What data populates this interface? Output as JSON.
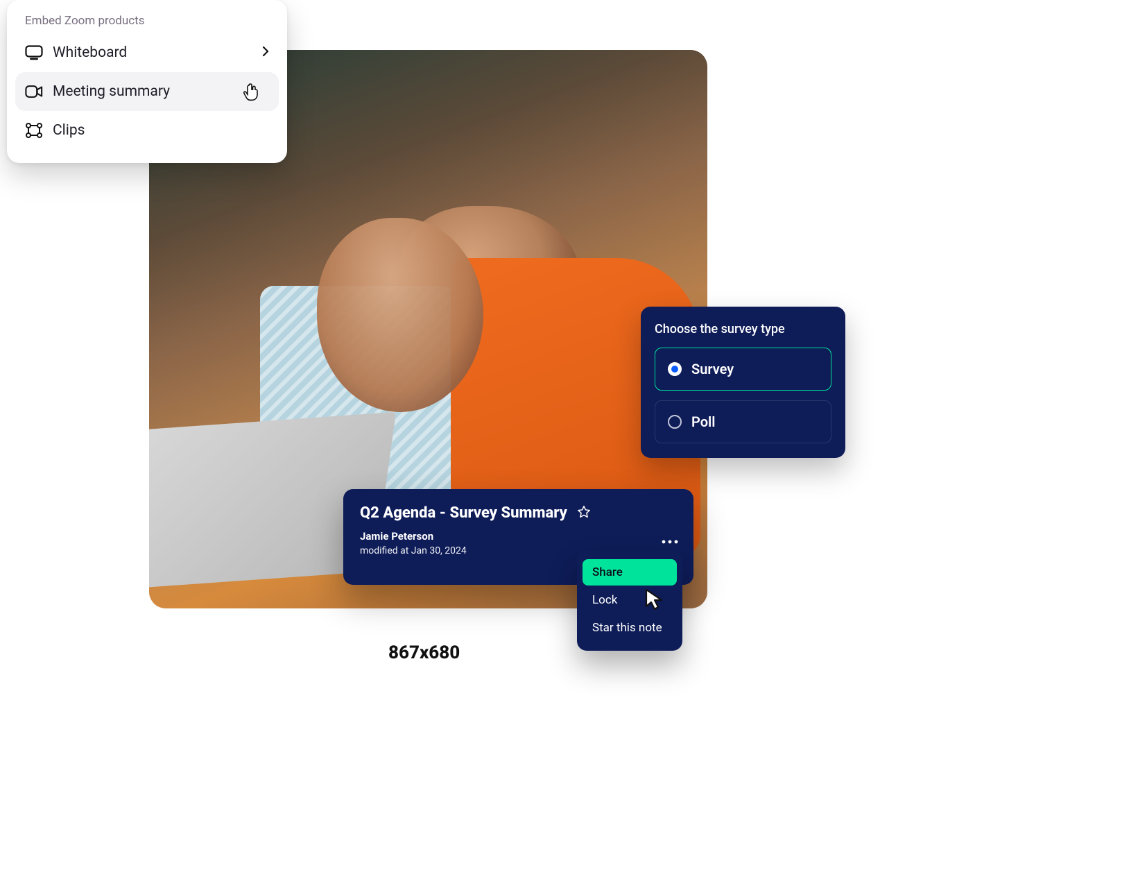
{
  "embed": {
    "title": "Embed Zoom products",
    "items": [
      {
        "label": "Whiteboard",
        "has_sub": true
      },
      {
        "label": "Meeting summary",
        "has_sub": false
      },
      {
        "label": "Clips",
        "has_sub": false
      }
    ]
  },
  "survey": {
    "title": "Choose the survey type",
    "options": [
      {
        "label": "Survey",
        "selected": true
      },
      {
        "label": "Poll",
        "selected": false
      }
    ]
  },
  "agenda": {
    "title": "Q2 Agenda - Survey Summary",
    "author": "Jamie Peterson",
    "modified": "modified at Jan 30, 2024"
  },
  "ctx": {
    "items": [
      {
        "label": "Share",
        "highlight": true
      },
      {
        "label": "Lock",
        "highlight": false
      },
      {
        "label": "Star this note",
        "highlight": false
      }
    ]
  },
  "dimensions": "867x680"
}
